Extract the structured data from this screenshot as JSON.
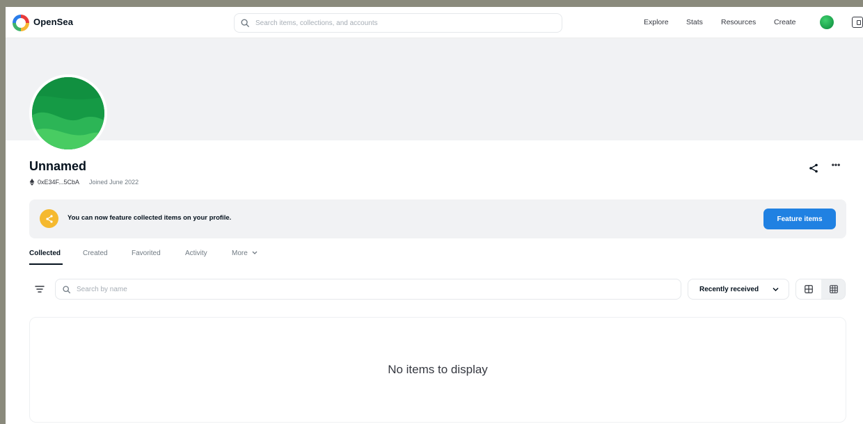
{
  "brand": {
    "name": "OpenSea"
  },
  "nav": {
    "search_placeholder": "Search items, collections, and accounts",
    "links": [
      "Explore",
      "Stats",
      "Resources",
      "Create"
    ]
  },
  "profile": {
    "name": "Unnamed",
    "address": "0xE34F...5CbA",
    "joined": "Joined June 2022"
  },
  "notice": {
    "text": "You can now feature collected items on your profile.",
    "button_label": "Feature items"
  },
  "tabs": [
    {
      "label": "Collected",
      "active": true
    },
    {
      "label": "Created",
      "active": false
    },
    {
      "label": "Favorited",
      "active": false
    },
    {
      "label": "Activity",
      "active": false
    },
    {
      "label": "More",
      "active": false
    }
  ],
  "filters": {
    "search_placeholder": "Search by name",
    "sort_selected": "Recently received",
    "view_selected": "small-grid"
  },
  "empty_state": {
    "text": "No items to display"
  },
  "colors": {
    "accent_blue": "#2081e2",
    "notice_icon": "#f5b92f",
    "banner": "#f1f2f4",
    "avatar_green": "#18a04a"
  },
  "icons": [
    "search-icon",
    "ethereum-icon",
    "share-icon",
    "more-icon",
    "sparkle-icon",
    "filter-icon",
    "chevron-down-icon",
    "large-grid-icon",
    "small-grid-icon",
    "wallet-icon"
  ]
}
